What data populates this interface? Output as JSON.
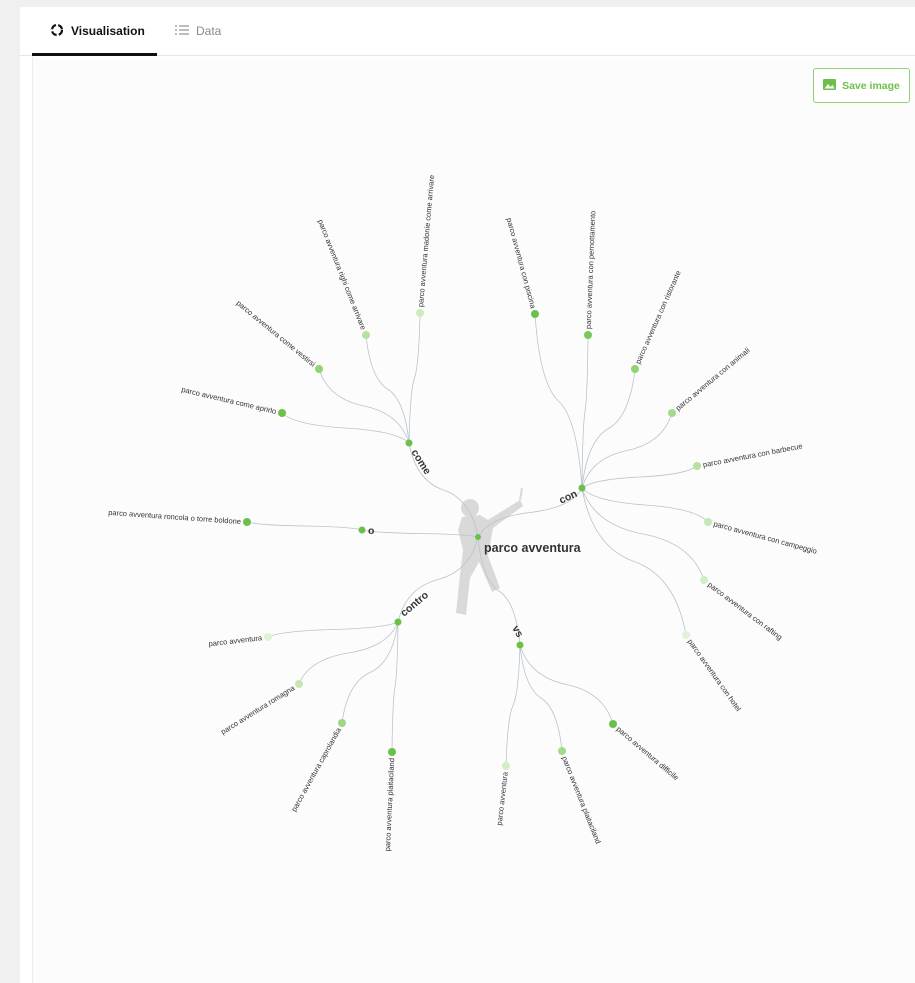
{
  "tabs": [
    {
      "label": "Visualisation",
      "icon": "circle-progress-icon",
      "active": true
    },
    {
      "label": "Data",
      "icon": "list-icon",
      "active": false
    }
  ],
  "toolbar": {
    "save_label": "Save image",
    "icon": "image-icon"
  },
  "colors": {
    "accent": "#6cc04a",
    "link": "#b9c4cc",
    "text": "#333333"
  },
  "graph": {
    "root": "parco avventura",
    "branches": [
      {
        "label": "come",
        "children": [
          "parco avventura madonie come arrivare",
          "parco avventura righi come arrivare",
          "parco avventura come vestirsi",
          "parco avventura come aprirlo"
        ]
      },
      {
        "label": "con",
        "children": [
          "parco avventura con piscina",
          "parco avventura con pernottamento",
          "parco avventura con ristorante",
          "parco avventura con animali",
          "parco avventura con barbecue",
          "parco avventura con campeggio",
          "parco avventura con rafting",
          "parco avventura con hotel"
        ]
      },
      {
        "label": "o",
        "children": [
          "parco avventura roncola o torre boldone"
        ]
      },
      {
        "label": "contro",
        "children": [
          "parco avventura",
          "parco avventura romagna",
          "parco avventura caprolandia",
          "parco avventura plaitaciland"
        ]
      },
      {
        "label": "vs",
        "children": [
          "parco avventura",
          "parco avventura plaitaciland",
          "parco avventura difficile"
        ]
      }
    ]
  }
}
